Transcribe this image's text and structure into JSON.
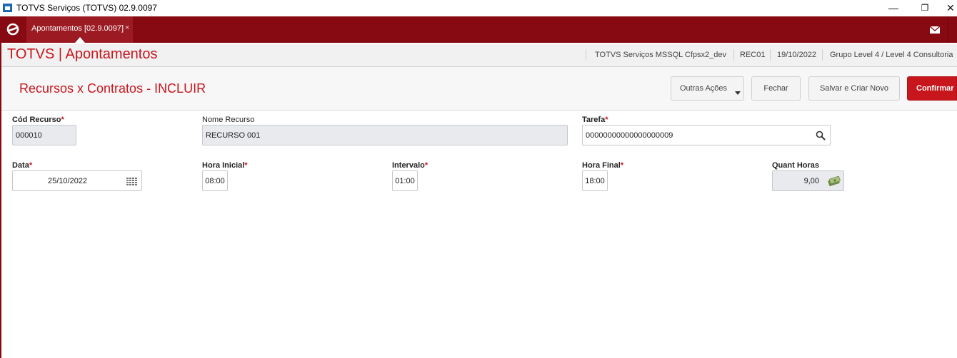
{
  "window": {
    "title": "TOTVS Serviços (TOTVS) 02.9.0097",
    "minimize": "—",
    "restore": "❐",
    "close": "✕"
  },
  "tabbar": {
    "tab_label": "Apontamentos [02.9.0097]",
    "tab_close": "×"
  },
  "header": {
    "app_title": "TOTVS | Apontamentos",
    "environment": "TOTVS Serviços MSSQL Cfpsx2_dev",
    "user": "REC01",
    "date": "19/10/2022",
    "group": "Grupo Level 4 / Level 4 Consultoria"
  },
  "form": {
    "title": "Recursos x Contratos - INCLUIR",
    "buttons": {
      "other_actions": "Outras Ações",
      "close": "Fechar",
      "save_new": "Salvar e Criar Novo",
      "confirm": "Confirmar"
    },
    "fields": {
      "cod_recurso": {
        "label": "Cód Recurso",
        "value": "000010"
      },
      "nome_recurso": {
        "label": "Nome Recurso",
        "value": "RECURSO 001"
      },
      "tarefa": {
        "label": "Tarefa",
        "value": "00000000000000000009"
      },
      "data": {
        "label": "Data",
        "value": "25/10/2022"
      },
      "hora_inicial": {
        "label": "Hora Inicial",
        "value": "08:00"
      },
      "intervalo": {
        "label": "Intervalo",
        "value": "01:00"
      },
      "hora_final": {
        "label": "Hora Final",
        "value": "18:00"
      },
      "quant_horas": {
        "label": "Quant Horas",
        "value": "9,00"
      }
    },
    "required_mark": "*"
  },
  "colors": {
    "brand_red": "#870a12",
    "accent_red": "#c8161d"
  },
  "icons": [
    "app-icon",
    "totvs-logo-icon",
    "mail-icon",
    "search-icon",
    "calendar-icon",
    "money-icon",
    "chevron-down-icon"
  ]
}
